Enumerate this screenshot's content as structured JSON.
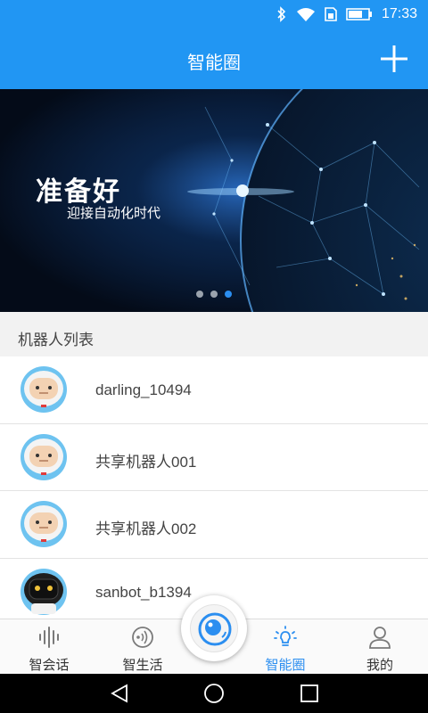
{
  "status_bar": {
    "time": "17:33"
  },
  "header": {
    "title": "智能圈",
    "add_icon": "plus-icon"
  },
  "banner": {
    "headline": "准备好",
    "subtitle": "迎接自动化时代",
    "slide_count": 3,
    "active_slide": 3
  },
  "section": {
    "title": "机器人列表"
  },
  "robots": [
    {
      "name": "darling_10494",
      "avatar": "white-robot-avatar"
    },
    {
      "name": "共享机器人001",
      "avatar": "white-robot-avatar"
    },
    {
      "name": "共享机器人002",
      "avatar": "white-robot-avatar"
    },
    {
      "name": "sanbot_b1394",
      "avatar": "black-robot-avatar"
    }
  ],
  "bottom_nav": {
    "tabs": [
      {
        "label": "智会话",
        "icon": "voice-wave-icon"
      },
      {
        "label": "智生活",
        "icon": "sound-ring-icon"
      },
      {
        "label": "智能圈",
        "icon": "lightbulb-icon",
        "active": true
      },
      {
        "label": "我的",
        "icon": "person-icon"
      }
    ],
    "center_icon": "eye-camera-icon"
  },
  "colors": {
    "primary": "#2196f3",
    "active_tab": "#2b8ef0"
  }
}
